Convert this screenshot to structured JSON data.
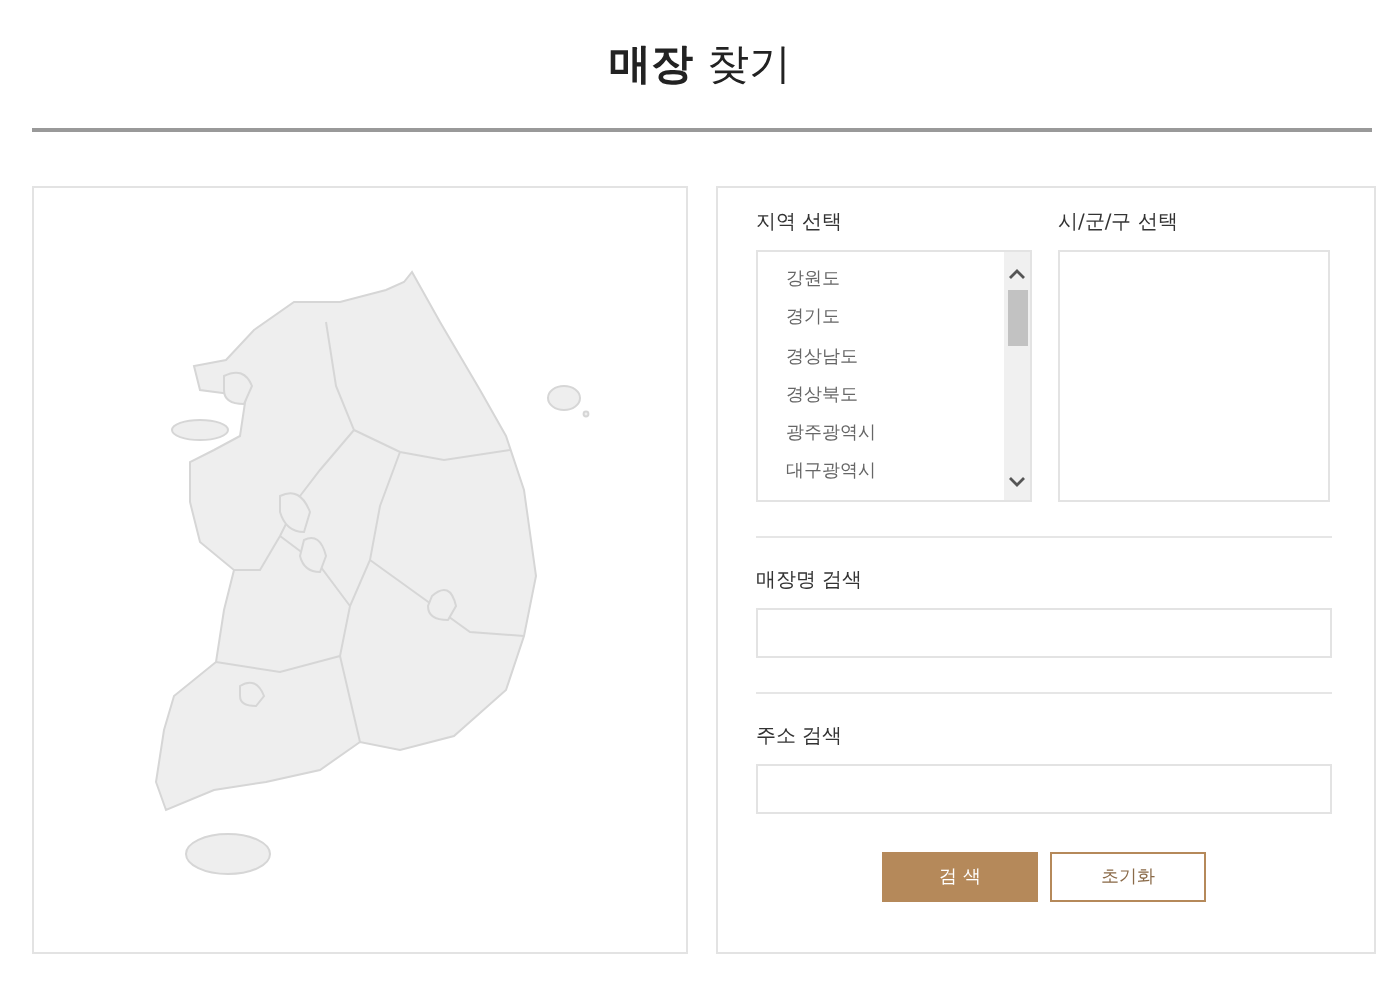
{
  "page": {
    "title": "**매장** 찾기"
  },
  "region_select": {
    "label": "지역 선택",
    "options": [
      "강원도",
      "경기도",
      "경상남도",
      "경상북도",
      "광주광역시",
      "대구광역시"
    ]
  },
  "district_select": {
    "label": "시/군/구 선택"
  },
  "store_name_search": {
    "label": "매장명 검색"
  },
  "address_search": {
    "label": "주소 검색"
  },
  "buttons": [
    {
      "label": "검 색",
      "kind": "primary"
    },
    {
      "label": "초기화",
      "kind": "secondary"
    }
  ]
}
